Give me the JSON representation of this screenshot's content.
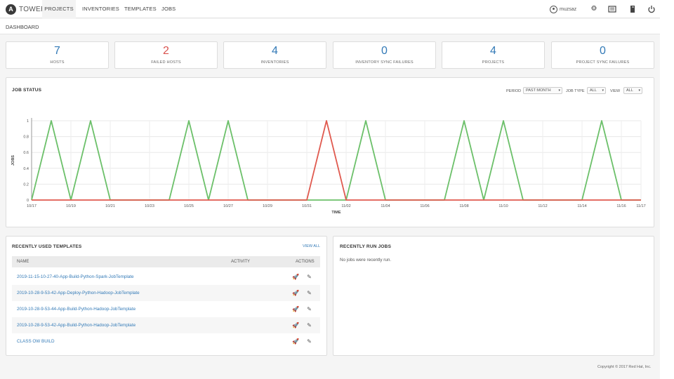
{
  "header": {
    "logo_letter": "A",
    "logo_text": "TOWER",
    "nav": [
      "PROJECTS",
      "INVENTORIES",
      "TEMPLATES",
      "JOBS"
    ],
    "username": "muzsaz",
    "icons": [
      "user-icon",
      "gear-icon",
      "activity-stream-icon",
      "docs-icon",
      "power-icon"
    ]
  },
  "breadcrumb": "DASHBOARD",
  "counts": [
    {
      "value": "7",
      "label": "HOSTS",
      "color": "#337ab7"
    },
    {
      "value": "2",
      "label": "FAILED HOSTS",
      "color": "#d9534f"
    },
    {
      "value": "4",
      "label": "INVENTORIES",
      "color": "#337ab7"
    },
    {
      "value": "0",
      "label": "INVENTORY SYNC FAILURES",
      "color": "#337ab7"
    },
    {
      "value": "4",
      "label": "PROJECTS",
      "color": "#337ab7"
    },
    {
      "value": "0",
      "label": "PROJECT SYNC FAILURES",
      "color": "#337ab7"
    }
  ],
  "job_status": {
    "title": "JOB STATUS",
    "filters": {
      "period_label": "PERIOD",
      "period_value": "PAST MONTH",
      "job_type_label": "JOB TYPE",
      "job_type_value": "ALL",
      "view_label": "VIEW",
      "view_value": "ALL"
    }
  },
  "chart_data": {
    "type": "line",
    "xlabel": "TIME",
    "ylabel": "JOBS",
    "ylim": [
      0,
      1
    ],
    "yticks": [
      "0",
      "0.2",
      "0.4",
      "0.6",
      "0.8",
      "1"
    ],
    "x_tick_labels": [
      "10/17",
      "10/19",
      "10/21",
      "10/23",
      "10/25",
      "10/27",
      "10/29",
      "10/31",
      "11/02",
      "11/04",
      "11/06",
      "11/08",
      "11/10",
      "11/12",
      "11/14",
      "11/16",
      "11/17"
    ],
    "x": [
      "10/17",
      "10/18",
      "10/19",
      "10/20",
      "10/21",
      "10/22",
      "10/23",
      "10/24",
      "10/25",
      "10/26",
      "10/27",
      "10/28",
      "10/29",
      "10/30",
      "10/31",
      "11/01",
      "11/02",
      "11/03",
      "11/04",
      "11/05",
      "11/06",
      "11/07",
      "11/08",
      "11/09",
      "11/10",
      "11/11",
      "11/12",
      "11/13",
      "11/14",
      "11/15",
      "11/16",
      "11/17"
    ],
    "series": [
      {
        "color": "#6cc06a",
        "values": [
          0,
          1,
          0,
          1,
          0,
          0,
          0,
          0,
          1,
          0,
          1,
          0,
          0,
          0,
          0,
          0,
          0,
          1,
          0,
          0,
          0,
          0,
          1,
          0,
          1,
          0,
          0,
          0,
          0,
          1,
          0,
          0
        ]
      },
      {
        "color": "#e05a4f",
        "values": [
          0,
          0,
          0,
          0,
          0,
          0,
          0,
          0,
          0,
          0,
          0,
          0,
          0,
          0,
          0,
          1,
          0,
          0,
          0,
          0,
          0,
          0,
          0,
          0,
          0,
          0,
          0,
          0,
          0,
          0,
          0,
          0
        ]
      }
    ],
    "grid": true
  },
  "templates": {
    "title": "RECENTLY USED TEMPLATES",
    "view_all": "VIEW ALL",
    "columns": [
      "NAME",
      "ACTIVITY",
      "ACTIONS"
    ],
    "rows": [
      "2019-11-15-10-27-40-App-Build-Python-Spark-JobTemplate",
      "2019-10-28-9-53-42-App-Deploy-Python-Hadoop-JobTemplate",
      "2019-10-28-9-53-44-App-Build-Python-Hadoop-JobTemplate",
      "2019-10-28-9-53-42-App-Build-Python-Hadoop-JobTemplate",
      "CLASS OW BUILD"
    ]
  },
  "recent_jobs": {
    "title": "RECENTLY RUN JOBS",
    "empty_text": "No jobs were recently run."
  },
  "footer": "Copyright © 2017 Red Hat, Inc."
}
